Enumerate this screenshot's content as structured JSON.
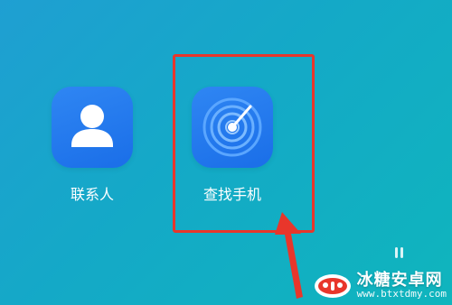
{
  "apps": [
    {
      "label": "联系人",
      "icon": "contacts-person-icon"
    },
    {
      "label": "查找手机",
      "icon": "find-phone-radar-icon"
    }
  ],
  "annotation": {
    "highlight_color": "#e8362b",
    "arrow_color": "#e8362b"
  },
  "watermark": {
    "title": "冰糖安卓网",
    "url": "www.btxtdmy.com"
  },
  "colors": {
    "background_start": "#1f9fd2",
    "background_end": "#0fb5bd",
    "tile": "#2f86f3"
  }
}
